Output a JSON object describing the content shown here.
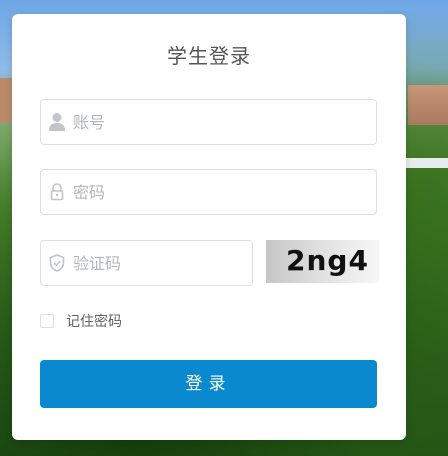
{
  "login": {
    "title": "学生登录",
    "username": {
      "placeholder": "账号",
      "value": "",
      "icon": "user-icon"
    },
    "password": {
      "placeholder": "密码",
      "value": "",
      "icon": "lock-icon"
    },
    "captcha": {
      "placeholder": "验证码",
      "value": "",
      "icon": "shield-icon",
      "image_text": "2ng4"
    },
    "remember_label": "记住密码",
    "remember_checked": false,
    "submit_label": "登录"
  },
  "colors": {
    "primary_button": "#0a89cf",
    "panel_background": "#ffffff",
    "input_border": "#dcdfe6",
    "placeholder": "#b3b6bc"
  }
}
